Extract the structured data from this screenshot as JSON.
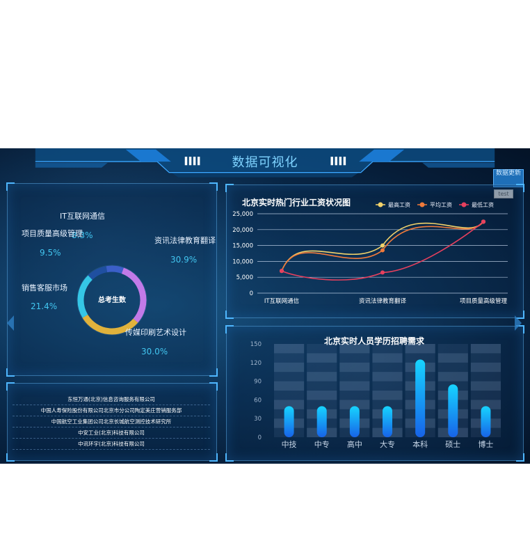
{
  "header": {
    "title": "数据可视化"
  },
  "controls": {
    "update_label": "数据更新",
    "test_label": "test"
  },
  "donut": {
    "center_label": "总考生数",
    "slices": [
      {
        "name": "IT互联网通信",
        "percent": "8.3%",
        "value": 8.3,
        "color": "#3b5fc8"
      },
      {
        "name": "资讯法律教育翻译",
        "percent": "30.9%",
        "value": 30.9,
        "color": "#c27ae8"
      },
      {
        "name": "传媒印刷艺术设计",
        "percent": "30.0%",
        "value": 30.0,
        "color": "#e0b23c"
      },
      {
        "name": "销售客服市场",
        "percent": "21.4%",
        "value": 21.4,
        "color": "#35c6e6"
      },
      {
        "name": "项目质量高级管理",
        "percent": "9.5%",
        "value": 9.5,
        "color": "#1f4fa0"
      }
    ]
  },
  "companies": [
    "东恒万通(北京)信息咨询服务有限公司",
    "中国人寿保险股份有限公司北京市分公司陶定美庄营销服务部",
    "中国航空工业集团公司北京长城航空测控技术研究所",
    "中安工业(北京)科技有限公司",
    "中讯环宇(北京)科技有限公司"
  ],
  "chart_data": [
    {
      "type": "line",
      "title": "北京实时热门行业工资状况图",
      "categories": [
        "IT互联网通信",
        "资讯法律教育翻译",
        "项目质量高级管理"
      ],
      "ylim": [
        0,
        25000
      ],
      "y_ticks": [
        "0",
        "5,000",
        "10,000",
        "15,000",
        "20,000",
        "25,000"
      ],
      "legend": "top-right",
      "series": [
        {
          "name": "最高工资",
          "color": "#f2d36b",
          "values": [
            7000,
            15000,
            22500
          ]
        },
        {
          "name": "平均工资",
          "color": "#ef7a3b",
          "values": [
            7000,
            13500,
            22500
          ]
        },
        {
          "name": "最低工资",
          "color": "#e6405e",
          "values": [
            7000,
            6500,
            22500
          ]
        }
      ]
    },
    {
      "type": "bar",
      "title": "北京实时人员学历招聘需求",
      "categories": [
        "中技",
        "中专",
        "高中",
        "大专",
        "本科",
        "硕士",
        "博士"
      ],
      "values": [
        50,
        50,
        50,
        50,
        125,
        85,
        50
      ],
      "ylim": [
        0,
        150
      ],
      "y_ticks": [
        "0",
        "30",
        "60",
        "90",
        "120",
        "150"
      ]
    }
  ]
}
